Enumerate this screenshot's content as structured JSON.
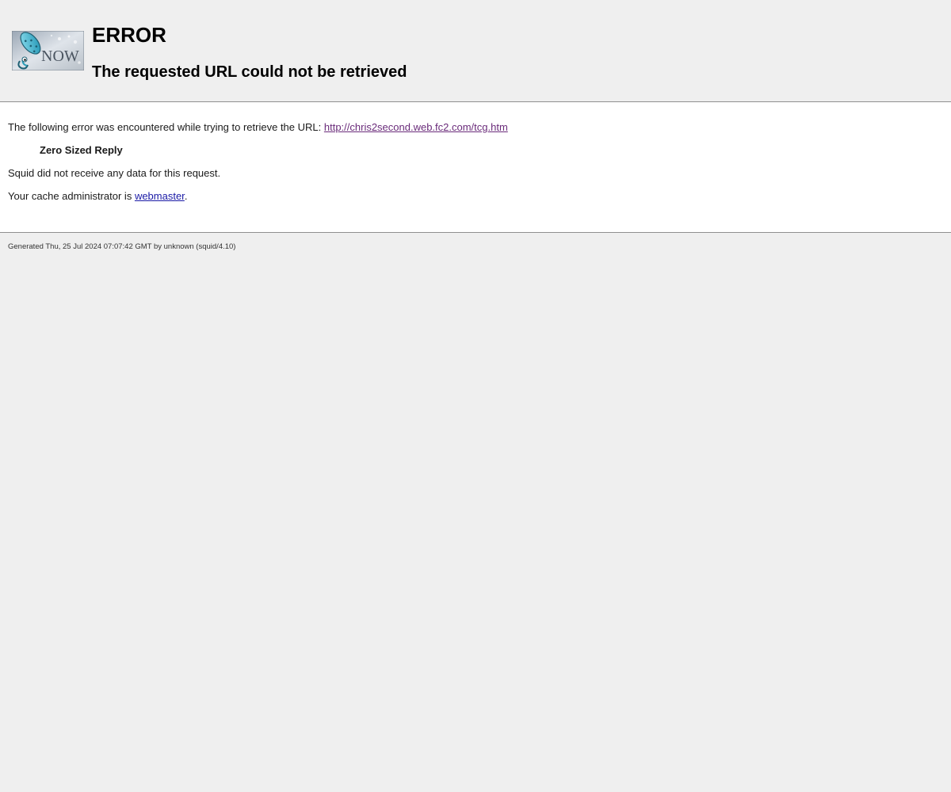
{
  "header": {
    "logo_text": "NOW",
    "title": "ERROR",
    "subtitle": "The requested URL could not be retrieved"
  },
  "content": {
    "intro_text": "The following error was encountered while trying to retrieve the URL: ",
    "url": "http://chris2second.web.fc2.com/tcg.htm",
    "error_name": "Zero Sized Reply",
    "error_description": "Squid did not receive any data for this request.",
    "admin_prefix": "Your cache administrator is ",
    "admin_link": "webmaster",
    "admin_suffix": "."
  },
  "footer": {
    "generated": "Generated Thu, 25 Jul 2024 07:07:42 GMT by unknown (squid/4.10)"
  },
  "colors": {
    "background": "#efefef",
    "content_bg": "#ffffff",
    "visited_link": "#6a2b7a",
    "link": "#1a1aa6"
  }
}
